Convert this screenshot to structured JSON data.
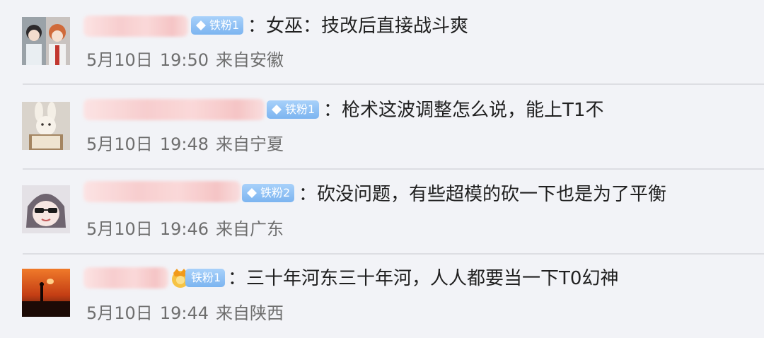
{
  "colors": {
    "background": "#f2f3f7",
    "divider": "#dddee3",
    "badge_blue": "#7cb4f0",
    "text": "#202020",
    "meta_text": "#6e6e6e"
  },
  "comments": [
    {
      "avatar_icon": "anime-characters-avatar",
      "badge_type": "fan-badge",
      "badge_label": "铁粉1",
      "separator": "：",
      "text": "女巫：技改后直接战斗爽",
      "date": "5月10日",
      "time": "19:50",
      "location": "来自安徽"
    },
    {
      "avatar_icon": "plush-rabbit-avatar",
      "badge_type": "fan-badge",
      "badge_label": "铁粉1",
      "separator": "：",
      "text": "枪术这波调整怎么说，能上T1不",
      "date": "5月10日",
      "time": "19:48",
      "location": "来自宁夏"
    },
    {
      "avatar_icon": "sunglasses-girl-avatar",
      "badge_type": "fan-badge",
      "badge_label": "铁粉2",
      "separator": "：",
      "text": "砍没问题，有些超模的砍一下也是为了平衡",
      "date": "5月10日",
      "time": "19:46",
      "location": "来自广东"
    },
    {
      "avatar_icon": "sunset-silhouette-avatar",
      "badge_type": "crown-fan-badge",
      "badge_label": "铁粉1",
      "separator": "：",
      "text": "三十年河东三十年河，人人都要当一下T0幻神",
      "date": "5月10日",
      "time": "19:44",
      "location": "来自陕西"
    }
  ]
}
